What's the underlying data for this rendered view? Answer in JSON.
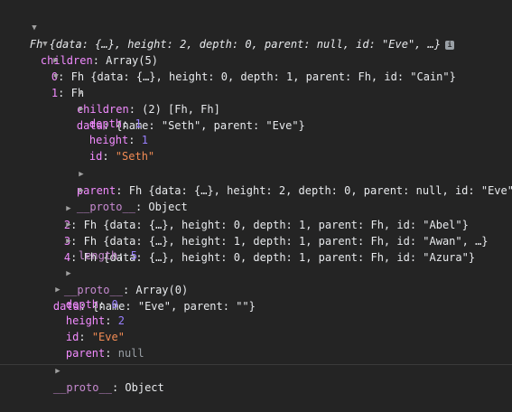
{
  "console": {
    "root": {
      "preview_class": "Fh",
      "preview_rest": " {data: {…}, height: 2, depth: 0, parent: null, id: \"Eve\", …}",
      "info_badge": "i",
      "children_label": "children",
      "children_value": "Array(5)",
      "items": [
        {
          "index": "0",
          "summary": "Fh {data: {…}, height: 0, depth: 1, parent: Fh, id: \"Cain\"}"
        },
        {
          "index": "1",
          "summary": "Fh"
        },
        {
          "index": "2",
          "summary": "Fh {data: {…}, height: 0, depth: 1, parent: Fh, id: \"Abel\"}"
        },
        {
          "index": "3",
          "summary": "Fh {data: {…}, height: 1, depth: 1, parent: Fh, id: \"Awan\", …}"
        },
        {
          "index": "4",
          "summary": "Fh {data: {…}, height: 0, depth: 1, parent: Fh, id: \"Azura\"}"
        }
      ],
      "seth": {
        "children_label": "children",
        "children_value": "(2) [Fh, Fh]",
        "data_label": "data",
        "data_value": "{name: \"Seth\", parent: \"Eve\"}",
        "depth_label": "depth",
        "depth_value": "1",
        "height_label": "height",
        "height_value": "1",
        "id_label": "id",
        "id_value": "\"Seth\"",
        "parent_label": "parent",
        "parent_value": "Fh {data: {…}, height: 2, depth: 0, parent: null, id: \"Eve\",",
        "proto_label": "__proto__",
        "proto_value": "Object"
      },
      "length_label": "length",
      "length_value": "5",
      "arr_proto_label": "__proto__",
      "arr_proto_value": "Array(0)",
      "data_label": "data",
      "data_value": "{name: \"Eve\", parent: \"\"}",
      "depth_label": "depth",
      "depth_value": "0",
      "height_label": "height",
      "height_value": "2",
      "id_label": "id",
      "id_value": "\"Eve\"",
      "parent_label": "parent",
      "parent_value": "null",
      "proto_label": "__proto__",
      "proto_value": "Object"
    }
  }
}
